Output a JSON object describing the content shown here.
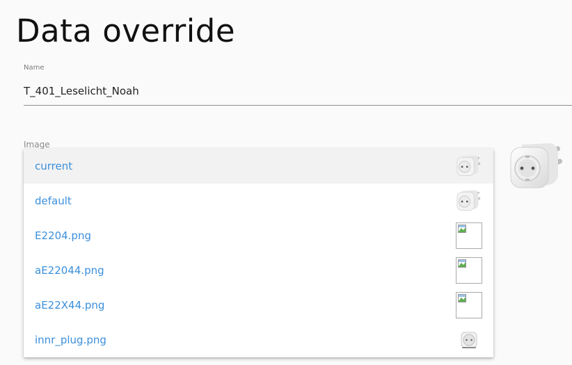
{
  "page": {
    "title": "Data override"
  },
  "name_field": {
    "label": "Name",
    "value": "T_401_Leselicht_Noah"
  },
  "image_field": {
    "label": "Image",
    "options": [
      {
        "label": "current",
        "thumbnail": "plug-icon",
        "selected": true
      },
      {
        "label": "default",
        "thumbnail": "plug-icon",
        "selected": false
      },
      {
        "label": "E2204.png",
        "thumbnail": "broken-image-icon",
        "selected": false
      },
      {
        "label": "aE22044.png",
        "thumbnail": "broken-image-icon",
        "selected": false
      },
      {
        "label": "aE22X44.png",
        "thumbnail": "broken-image-icon",
        "selected": false
      },
      {
        "label": "innr_plug.png",
        "thumbnail": "small-plug-icon",
        "selected": false
      }
    ]
  },
  "preview": {
    "icon": "plug-icon"
  },
  "colors": {
    "option_text": "#3a8fdc",
    "selected_bg": "#f2f2f2",
    "page_bg": "#fafafa"
  }
}
